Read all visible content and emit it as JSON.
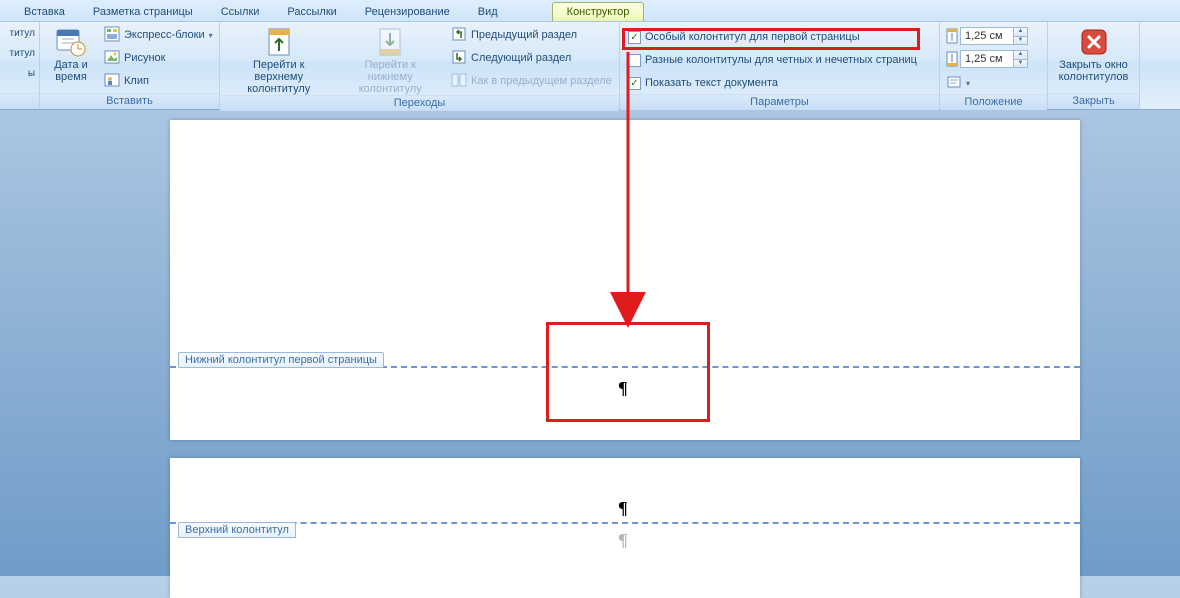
{
  "tabs": {
    "items": [
      {
        "label": "Вставка"
      },
      {
        "label": "Разметка страницы"
      },
      {
        "label": "Ссылки"
      },
      {
        "label": "Рассылки"
      },
      {
        "label": "Рецензирование"
      },
      {
        "label": "Вид"
      },
      {
        "label": "Конструктор"
      }
    ],
    "active_index": 6
  },
  "ribbon": {
    "group_hf": {
      "header_label": "титул",
      "footer_label": "титул",
      "pagenum_label": "ы"
    },
    "group_insert": {
      "label": "Вставить",
      "datetime_label": "Дата и время",
      "quickparts_label": "Экспресс-блоки",
      "picture_label": "Рисунок",
      "clip_label": "Клип"
    },
    "group_nav": {
      "label": "Переходы",
      "goto_header_label": "Перейти к верхнему колонтитулу",
      "goto_footer_label": "Перейти к нижнему колонтитулу",
      "prev_section_label": "Предыдущий раздел",
      "next_section_label": "Следующий раздел",
      "link_previous_label": "Как в предыдущем разделе"
    },
    "group_options": {
      "label": "Параметры",
      "different_first_label": "Особый колонтитул для первой страницы",
      "different_first_checked": true,
      "different_oddeven_label": "Разные колонтитулы для четных и нечетных страниц",
      "different_oddeven_checked": false,
      "show_doc_text_label": "Показать текст документа",
      "show_doc_text_checked": true
    },
    "group_position": {
      "label": "Положение",
      "header_from_top_value": "1,25 см",
      "footer_from_bottom_value": "1,25 см"
    },
    "group_close": {
      "label": "Закрыть",
      "close_label": "Закрыть окно колонтитулов"
    }
  },
  "document": {
    "footer_tag_label": "Нижний колонтитул первой страницы",
    "header_tag_label": "Верхний колонтитул",
    "pilcrow": "¶"
  }
}
